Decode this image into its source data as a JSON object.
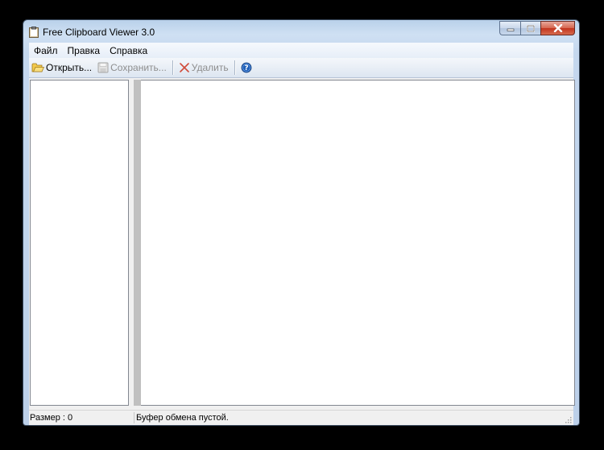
{
  "window": {
    "title": "Free Clipboard Viewer 3.0"
  },
  "menu": {
    "items": [
      "Файл",
      "Правка",
      "Справка"
    ]
  },
  "toolbar": {
    "open_label": "Открыть...",
    "save_label": "Сохранить...",
    "delete_label": "Удалить"
  },
  "status": {
    "size": "Размер : 0",
    "message": "Буфер обмена пустой."
  },
  "colors": {
    "close_button": "#c2341d",
    "help_icon": "#1f5fb8"
  }
}
